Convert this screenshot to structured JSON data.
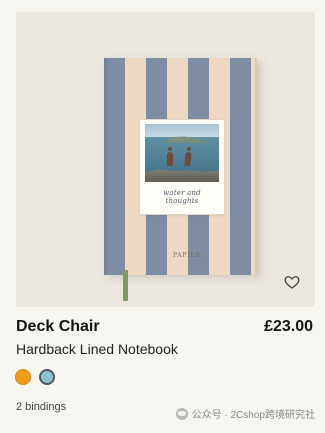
{
  "product": {
    "title": "Deck Chair",
    "price": "£23.00",
    "subtitle": "Hardback Lined Notebook",
    "binding_count_text": "2 bindings",
    "photo_caption": "water and thoughts",
    "cover_brand": "PAPIER"
  },
  "swatches": [
    {
      "name": "orange",
      "color": "#f09b1a"
    },
    {
      "name": "blue",
      "color": "#8dc2d3"
    }
  ],
  "icons": {
    "favorite": "heart-outline-icon",
    "watermark": "wechat-icon"
  },
  "watermark": {
    "text": "公众号 · 2Cshop跨境研究社"
  }
}
